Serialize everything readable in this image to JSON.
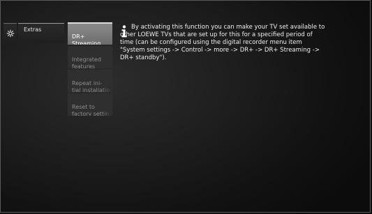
{
  "menu": {
    "icon": "gear-icon",
    "title": "Extras"
  },
  "submenu": {
    "items": [
      {
        "label": "DR+\nStreaming",
        "active": true
      },
      {
        "label": "Integrated\nfeatures",
        "active": false
      },
      {
        "label": "Repeat ini-\ntial installatio",
        "active": false
      },
      {
        "label": "Reset to\nfactory settin",
        "active": false
      }
    ]
  },
  "info": {
    "icon": "info-icon",
    "text": "By activating this function you can make your TV set available to other LOEWE TVs that are set up for this for a specified period of time (can be configured using the digital recorder menu item \"System settings -> Control -> more -> DR+ -> DR+ Streaming -> DR+ standby\")."
  },
  "colors": {
    "background": "#1a1a1a",
    "active_item": "#7a7a7a",
    "inactive_item": "#2f2f2f",
    "text": "#f0f0f0"
  }
}
